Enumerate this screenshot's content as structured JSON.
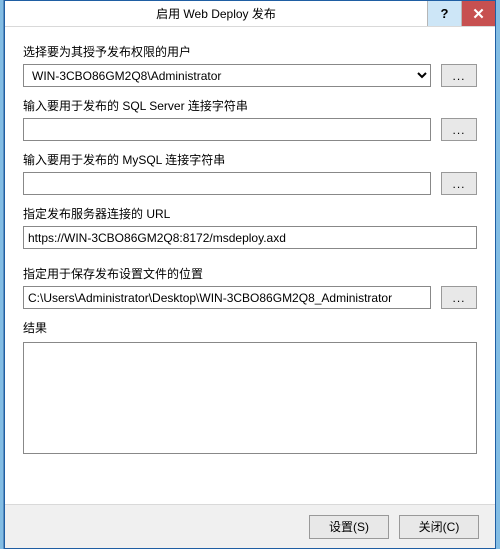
{
  "titlebar": {
    "title": "启用 Web Deploy 发布",
    "help_glyph": "?",
    "close_glyph": "✕"
  },
  "labels": {
    "user": "选择要为其授予发布权限的用户",
    "sql": "输入要用于发布的 SQL Server 连接字符串",
    "mysql": "输入要用于发布的 MySQL 连接字符串",
    "url": "指定发布服务器连接的 URL",
    "savepath": "指定用于保存发布设置文件的位置",
    "results": "结果"
  },
  "values": {
    "user": "WIN-3CBO86GM2Q8\\Administrator",
    "sql": "",
    "mysql": "",
    "url": "https://WIN-3CBO86GM2Q8:8172/msdeploy.axd",
    "savepath": "C:\\Users\\Administrator\\Desktop\\WIN-3CBO86GM2Q8_Administrator",
    "results": ""
  },
  "browse_label": "...",
  "buttons": {
    "setup": "设置(S)",
    "close": "关闭(C)"
  }
}
